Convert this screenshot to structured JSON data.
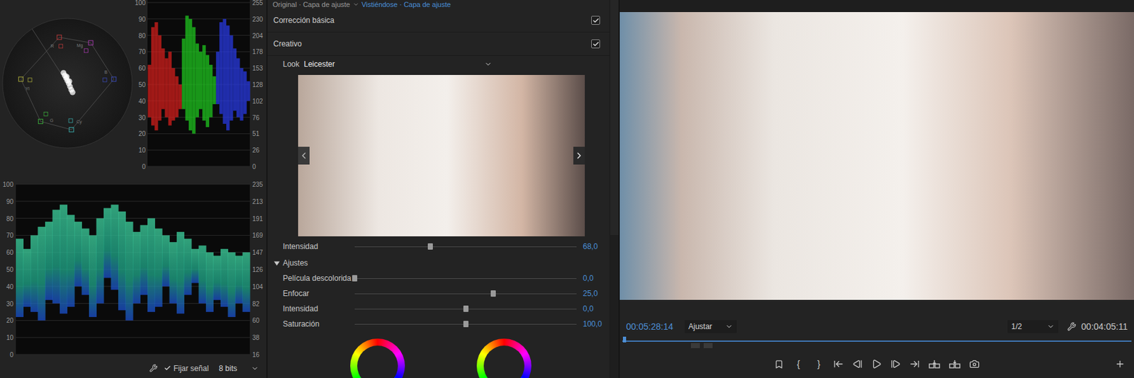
{
  "scopes": {
    "vectorscope": {
      "targets": [
        {
          "label": "R"
        },
        {
          "label": "Mg"
        },
        {
          "label": "B"
        },
        {
          "label": "Cy"
        },
        {
          "label": "G"
        },
        {
          "label": "Yl"
        }
      ],
      "trace": [
        {
          "u": -0.06,
          "v": 0.16
        },
        {
          "u": -0.04,
          "v": 0.12
        },
        {
          "u": -0.02,
          "v": 0.08
        },
        {
          "u": 0.0,
          "v": 0.04
        },
        {
          "u": 0.02,
          "v": 0.0
        },
        {
          "u": 0.04,
          "v": -0.05
        },
        {
          "u": 0.06,
          "v": -0.1
        },
        {
          "u": 0.08,
          "v": -0.14
        },
        {
          "u": -0.01,
          "v": 0.1
        },
        {
          "u": 0.03,
          "v": 0.03
        }
      ]
    },
    "parade": {
      "left_ticks": [
        "100",
        "90",
        "80",
        "70",
        "60",
        "50",
        "40",
        "30",
        "20",
        "10",
        "0"
      ],
      "right_ticks": [
        "255",
        "230",
        "204",
        "178",
        "153",
        "128",
        "102",
        "76",
        "51",
        "26",
        "0"
      ],
      "channels": [
        {
          "color": "#e0201c",
          "high": [
            62,
            85,
            88,
            80,
            72,
            66,
            70,
            60,
            55,
            50
          ],
          "low": [
            30,
            25,
            22,
            28,
            35,
            30,
            25,
            28,
            30,
            35
          ]
        },
        {
          "color": "#1fd11f",
          "high": [
            78,
            92,
            90,
            85,
            75,
            70,
            74,
            68,
            62,
            55
          ],
          "low": [
            35,
            28,
            22,
            20,
            30,
            35,
            28,
            24,
            30,
            38
          ]
        },
        {
          "color": "#2a3cf0",
          "high": [
            70,
            88,
            90,
            86,
            80,
            72,
            66,
            60,
            58,
            52
          ],
          "low": [
            38,
            32,
            26,
            22,
            28,
            34,
            30,
            28,
            32,
            40
          ]
        }
      ]
    },
    "waveform": {
      "left_ticks": [
        "100",
        "90",
        "80",
        "70",
        "60",
        "50",
        "40",
        "30",
        "20",
        "10",
        "0"
      ],
      "right_ticks": [
        "235",
        "213",
        "191",
        "169",
        "147",
        "126",
        "104",
        "82",
        "60",
        "38",
        "16"
      ],
      "high": [
        68,
        62,
        70,
        75,
        78,
        85,
        88,
        82,
        78,
        74,
        70,
        80,
        86,
        88,
        84,
        78,
        72,
        76,
        80,
        74,
        70,
        66,
        72,
        68,
        62,
        64,
        60,
        58,
        62,
        60,
        58,
        60
      ],
      "low": [
        22,
        28,
        25,
        20,
        32,
        30,
        24,
        28,
        40,
        35,
        22,
        30,
        45,
        38,
        26,
        20,
        30,
        35,
        25,
        28,
        40,
        30,
        24,
        35,
        42,
        30,
        25,
        32,
        28,
        22,
        30,
        25
      ]
    },
    "toolbar": {
      "pin_signal": {
        "label": "Fijar señal",
        "checked": true
      },
      "bit_depth": "8 bits"
    }
  },
  "lumetri": {
    "breadcrumb": {
      "source": "Original · Capa de ajuste",
      "sequence": "Vistiéndose · Capa de ajuste"
    },
    "sections": [
      {
        "label": "Corrección básica",
        "checked": true
      },
      {
        "label": "Creativo",
        "checked": true
      }
    ],
    "look": {
      "label": "Look",
      "value": "Leicester"
    },
    "intensity": {
      "label": "Intensidad",
      "value": "68,0",
      "level": 0.34
    },
    "adjustments": {
      "label": "Ajustes",
      "expanded": true,
      "sliders": [
        {
          "label": "Película descolorida",
          "value": "0,0",
          "level": 0.0
        },
        {
          "label": "Enfocar",
          "value": "25,0",
          "level": 0.625
        },
        {
          "label": "Intensidad",
          "value": "0,0",
          "level": 0.5
        },
        {
          "label": "Saturación",
          "value": "100,0",
          "level": 0.5
        }
      ]
    }
  },
  "monitor": {
    "timecode": "00:05:28:14",
    "zoom": "Ajustar",
    "resolution": "1/2",
    "duration": "00:04:05:11",
    "playhead": {
      "level": 0.0
    },
    "mark_in": "{",
    "mark_out": "}"
  }
}
